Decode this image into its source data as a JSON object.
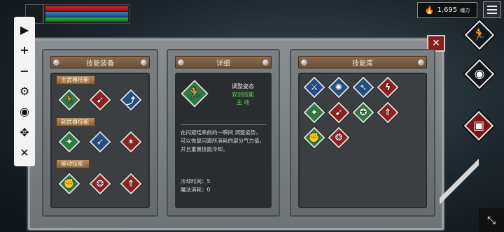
{
  "hud": {
    "soul_value": "1,695",
    "soul_unit": "魂力"
  },
  "toolbar": {
    "items": [
      {
        "name": "play",
        "glyph": "▶"
      },
      {
        "name": "zoom-in",
        "glyph": "+"
      },
      {
        "name": "zoom-out",
        "glyph": "−"
      },
      {
        "name": "settings",
        "glyph": "⚙"
      },
      {
        "name": "view",
        "glyph": "◉"
      },
      {
        "name": "move",
        "glyph": "✥"
      },
      {
        "name": "close",
        "glyph": "✕"
      }
    ]
  },
  "panels": {
    "equipment_title": "技能装备",
    "detail_title": "详细",
    "library_title": "技能库"
  },
  "equipment": {
    "sections": [
      {
        "label": "主武器技能",
        "icons": [
          {
            "icon": "dash-figure-icon",
            "color": "green",
            "glyph": "🏃"
          },
          {
            "icon": "charge-figure-icon",
            "color": "red",
            "glyph": "➹"
          },
          {
            "icon": "leap-figure-icon",
            "color": "blue",
            "glyph": "⤴"
          }
        ]
      },
      {
        "label": "副武器技能",
        "icons": [
          {
            "icon": "strength-figure-icon",
            "color": "green",
            "glyph": "✦"
          },
          {
            "icon": "throw-figure-icon",
            "color": "blue",
            "glyph": "➶"
          },
          {
            "icon": "claw-slash-icon",
            "color": "red",
            "glyph": "✶"
          }
        ]
      },
      {
        "label": "被动技能",
        "icons": [
          {
            "icon": "arm-muscle-icon",
            "color": "green",
            "glyph": "✊"
          },
          {
            "icon": "spine-icon",
            "color": "red",
            "glyph": "❂"
          },
          {
            "icon": "sword-up-icon",
            "color": "red",
            "glyph": "⇑"
          }
        ]
      }
    ]
  },
  "detail": {
    "skill_name": "调整姿态",
    "skill_category": "双剑技能",
    "skill_type": "主 动",
    "description": "在闪避结束前的一瞬间 调整姿势，可以恢复闪避所消耗的部分气力值，并且重置技能冷却。",
    "cooldown": "冷却时间：5",
    "mana_cost": "魔法消耗：0"
  },
  "library": {
    "rows": [
      [
        {
          "icon": "slash-figure-icon",
          "color": "blue",
          "glyph": "⚔"
        },
        {
          "icon": "spin-figure-icon",
          "color": "blue",
          "glyph": "✺"
        },
        {
          "icon": "blade-burst-icon",
          "color": "blue",
          "glyph": "➴"
        },
        {
          "icon": "fire-slash-icon",
          "color": "red",
          "glyph": "ϟ"
        }
      ],
      [
        {
          "icon": "power-figure-icon",
          "color": "green",
          "glyph": "✦"
        },
        {
          "icon": "lunge-figure-icon",
          "color": "red",
          "glyph": "➹"
        },
        {
          "icon": "kick-figure-icon",
          "color": "green",
          "glyph": "✪"
        },
        {
          "icon": "sword-rise-icon",
          "color": "red",
          "glyph": "⇑"
        }
      ],
      [
        {
          "icon": "arm-muscle-icon",
          "color": "green",
          "glyph": "✊"
        },
        {
          "icon": "spine-icon",
          "color": "red",
          "glyph": "❂"
        }
      ]
    ]
  },
  "actions": {
    "dash": "🏃",
    "eye": "◉",
    "book": "▣",
    "corner": "⤡"
  }
}
